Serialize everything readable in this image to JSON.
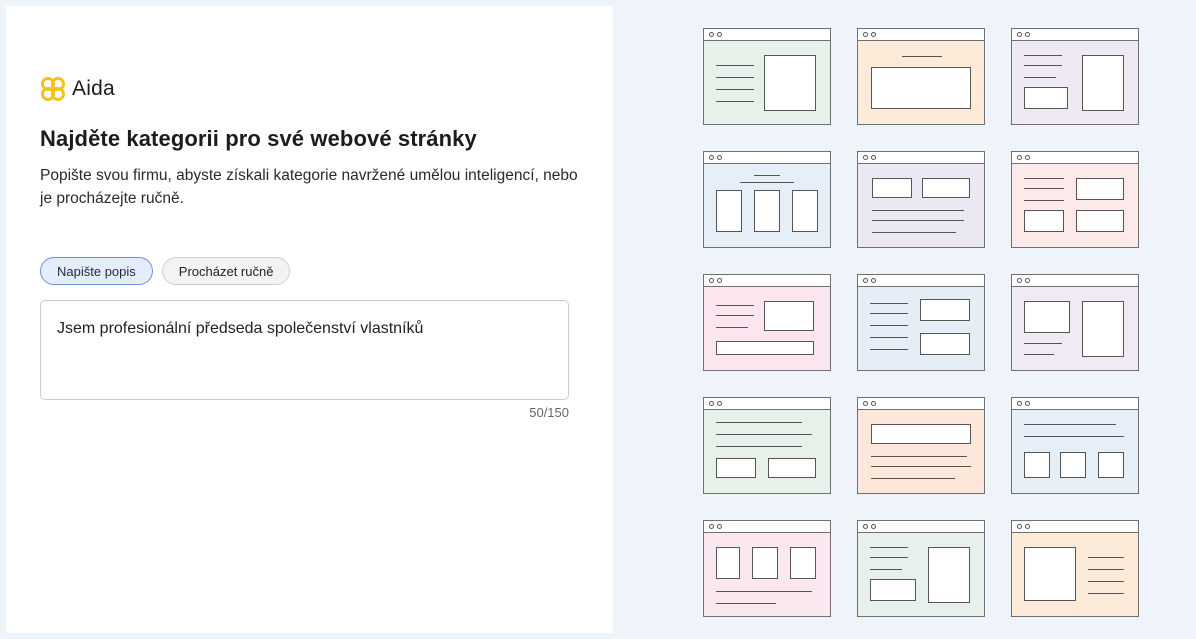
{
  "brand": {
    "name": "Aida",
    "logo_icon": "aida-logo-icon",
    "accent_color": "#f3c21c"
  },
  "heading": {
    "title": "Najděte kategorii pro své webové stránky",
    "subtitle": "Popište svou firmu, abyste získali kategorie navržené umělou inteligencí, nebo je procházejte ručně."
  },
  "modes": {
    "describe_label": "Napište popis",
    "browse_label": "Procházet ručně",
    "selected": "Napište popis"
  },
  "description": {
    "value": "Jsem profesionální předseda společenství vlastníků",
    "counter": "50/150"
  },
  "wireframe_colors": [
    "#e8f0ea",
    "#fdebd9",
    "#efe9f4",
    "#e6eff8",
    "#ebe8f3",
    "#fce9e9",
    "#fbe6ef",
    "#e5eef7",
    "#efeaf3",
    "#e8f0ea",
    "#fce7da",
    "#e6eff8",
    "#fbe7f0",
    "#e8f0ec",
    "#fdebd9"
  ]
}
